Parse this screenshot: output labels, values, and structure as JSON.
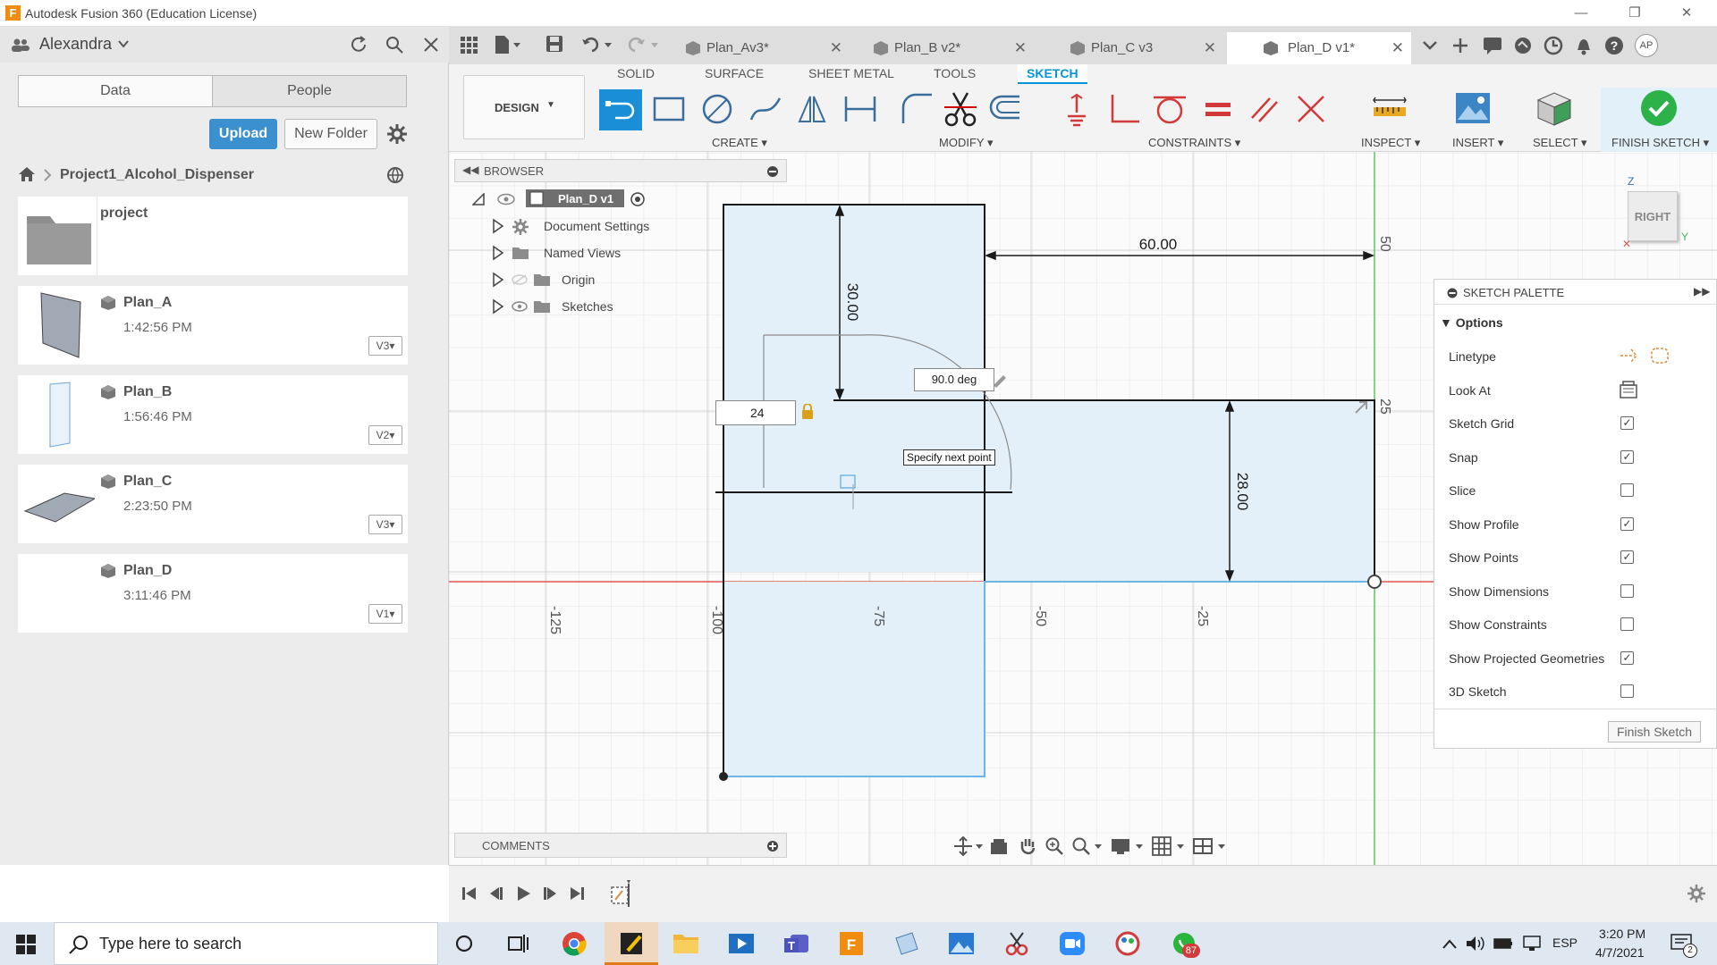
{
  "window": {
    "title": "Autodesk Fusion 360 (Education License)",
    "app_icon": "F"
  },
  "data_panel": {
    "user": "Alexandra",
    "tabs": [
      "Data",
      "People"
    ],
    "upload_label": "Upload",
    "new_folder_label": "New Folder",
    "breadcrumb": "Project1_Alcohol_Dispenser",
    "folder": {
      "name": "project"
    },
    "files": [
      {
        "name": "Plan_A",
        "time": "1:42:56 PM",
        "version": "V3"
      },
      {
        "name": "Plan_B",
        "time": "1:56:46 PM",
        "version": "V2"
      },
      {
        "name": "Plan_C",
        "time": "2:23:50 PM",
        "version": "V3"
      },
      {
        "name": "Plan_D",
        "time": "3:11:46 PM",
        "version": "V1"
      }
    ]
  },
  "doc_tabs": [
    {
      "label": "Plan_Av3*",
      "active": false
    },
    {
      "label": "Plan_B v2*",
      "active": false
    },
    {
      "label": "Plan_C v3",
      "active": false
    },
    {
      "label": "Plan_D v1*",
      "active": true
    }
  ],
  "user_initials": "AP",
  "toolbar": {
    "workspace": "DESIGN",
    "tabs": [
      "SOLID",
      "SURFACE",
      "SHEET METAL",
      "TOOLS",
      "SKETCH"
    ],
    "groups": {
      "create": "CREATE",
      "modify": "MODIFY",
      "constraints": "CONSTRAINTS",
      "inspect": "INSPECT",
      "insert": "INSERT",
      "select": "SELECT",
      "finish": "FINISH SKETCH"
    }
  },
  "browser": {
    "title": "BROWSER",
    "root": "Plan_D v1",
    "items": [
      "Document Settings",
      "Named Views",
      "Origin",
      "Sketches"
    ]
  },
  "comments_label": "COMMENTS",
  "viewcube": {
    "face": "RIGHT",
    "axis_z": "Z",
    "axis_y": "Y"
  },
  "sketch": {
    "dimensions": [
      "60.00",
      "30.00",
      "28.00"
    ],
    "angle_value": "90.0 deg",
    "length_input": "24",
    "tooltip": "Specify next point",
    "axis_ticks_h": [
      "-125",
      "-100",
      "-75",
      "-50",
      "-25"
    ],
    "axis_ticks_v": [
      "50",
      "25"
    ]
  },
  "palette": {
    "title": "SKETCH PALETTE",
    "section": "Options",
    "options": [
      {
        "label": "Linetype",
        "type": "icon"
      },
      {
        "label": "Look At",
        "type": "icon"
      },
      {
        "label": "Sketch Grid",
        "checked": true
      },
      {
        "label": "Snap",
        "checked": true
      },
      {
        "label": "Slice",
        "checked": false
      },
      {
        "label": "Show Profile",
        "checked": true
      },
      {
        "label": "Show Points",
        "checked": true
      },
      {
        "label": "Show Dimensions",
        "checked": false
      },
      {
        "label": "Show Constraints",
        "checked": false
      },
      {
        "label": "Show Projected Geometries",
        "checked": true
      },
      {
        "label": "3D Sketch",
        "checked": false
      }
    ],
    "finish_label": "Finish Sketch"
  },
  "taskbar": {
    "search_placeholder": "Type here to search",
    "lang": "ESP",
    "time": "3:20 PM",
    "date": "4/7/2021",
    "whatsapp_badge": "87",
    "notif_count": "2"
  },
  "colors": {
    "accent": "#0696d7",
    "profile_fill": "#e3f0fa",
    "x_axis": "#e05555",
    "y_axis": "#5ec55e",
    "finish_green": "#2db24a"
  }
}
